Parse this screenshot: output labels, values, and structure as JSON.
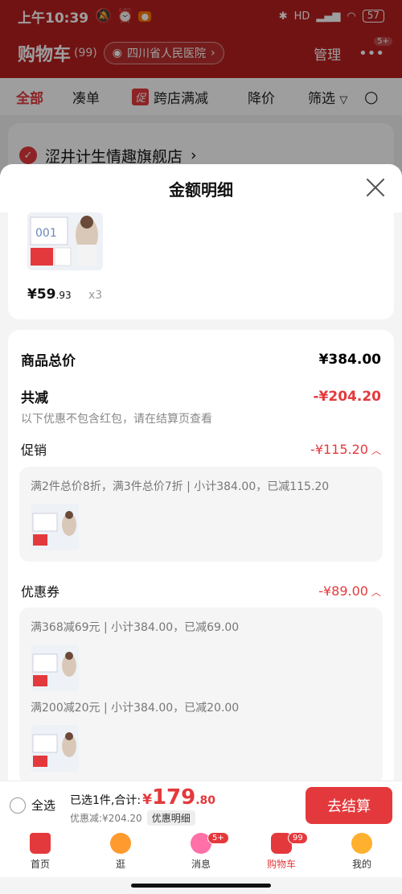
{
  "status_bar": {
    "time": "上午10:39",
    "network": "HD",
    "battery": "57"
  },
  "header": {
    "title": "购物车",
    "count": "(99)",
    "location": "四川省人民医院",
    "manage": "管理",
    "more_badge": "5+"
  },
  "tabs": {
    "all": "全部",
    "coudan": "凑单",
    "promo_tag": "促",
    "cross_store": "跨店满减",
    "price_drop": "降价",
    "filter": "筛选"
  },
  "store": {
    "name": "涩井计生情趣旗舰店"
  },
  "sheet": {
    "title": "金额明细",
    "product": {
      "price_int": "¥59",
      "price_dec": ".93",
      "qty": "x3"
    },
    "total_label": "商品总价",
    "total_value": "¥384.00",
    "discount_label": "共减",
    "discount_value": "-¥204.20",
    "discount_note": "以下优惠不包含红包，请在结算页查看",
    "promo_label": "促销",
    "promo_value": "-¥115.20",
    "promo_desc": "满2件总价8折，满3件总价7折 | 小计384.00，已减115.20",
    "coupon_label": "优惠券",
    "coupon_value": "-¥89.00",
    "coupon_desc_1": "满368减69元 | 小计384.00，已减69.00",
    "coupon_desc_2": "满200减20元 | 小计384.00，已减20.00"
  },
  "bottom": {
    "select_all": "全选",
    "selected_text": "已选1件,合计:",
    "currency": "¥",
    "total_int": "179",
    "total_dec": ".80",
    "discount_text": "优惠减:¥204.20",
    "detail_tag": "优惠明细",
    "checkout": "去结算"
  },
  "nav": {
    "home": "首页",
    "browse": "逛",
    "messages": "消息",
    "messages_badge": "5+",
    "cart": "购物车",
    "cart_badge": "99",
    "mine": "我的"
  },
  "colors": {
    "brand_red": "#e4393c",
    "header_red": "#b81f1f"
  }
}
